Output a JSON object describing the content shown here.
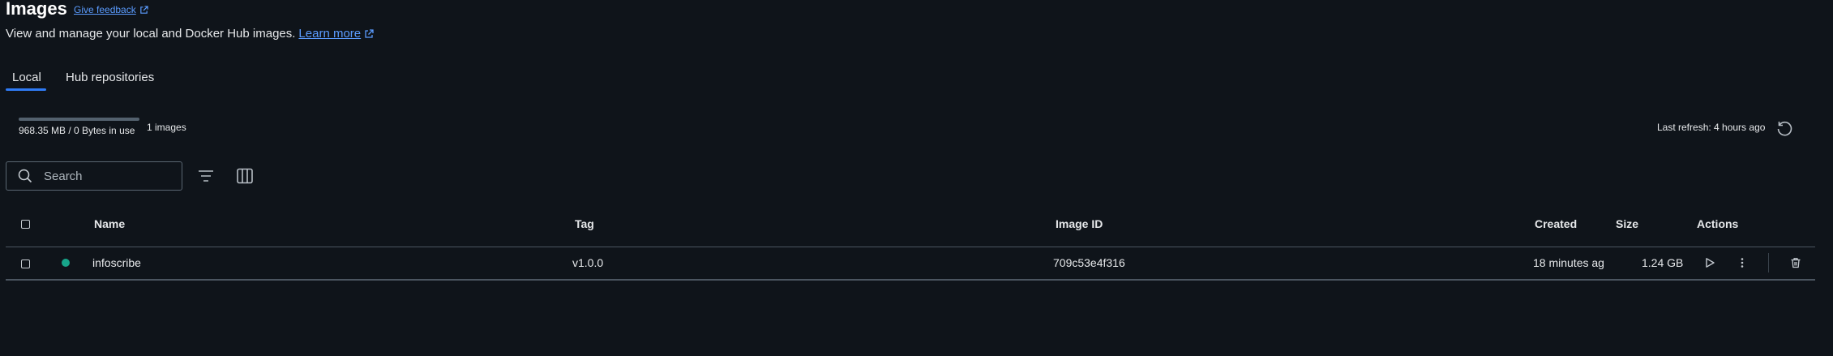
{
  "header": {
    "title": "Images",
    "feedback_label": "Give feedback",
    "subtitle": "View and manage your local and Docker Hub images.",
    "learn_more_label": "Learn more"
  },
  "tabs": [
    {
      "label": "Local",
      "active": true
    },
    {
      "label": "Hub repositories",
      "active": false
    }
  ],
  "usage": {
    "text": "968.35 MB / 0 Bytes in use",
    "count_label": "1 images",
    "last_refresh": "Last refresh: 4 hours ago"
  },
  "search": {
    "placeholder": "Search"
  },
  "table": {
    "columns": [
      "Name",
      "Tag",
      "Image ID",
      "Created",
      "Size",
      "Actions"
    ],
    "rows": [
      {
        "name": "infoscribe",
        "tag": "v1.0.0",
        "image_id": "709c53e4f316",
        "created": "18 minutes ag",
        "size": "1.24 GB",
        "status": "in-use"
      }
    ]
  },
  "icons": {
    "feedback": "external-link-icon",
    "learn_more": "external-link-icon",
    "refresh": "refresh-icon",
    "search": "search-icon",
    "filter": "filter-icon",
    "columns": "columns-icon",
    "run": "play-icon",
    "more": "more-vertical-icon",
    "delete": "trash-icon"
  },
  "colors": {
    "background": "#0f141a",
    "accent": "#2f7bf5",
    "link": "#5b9cff",
    "status_in_use": "#17a58a"
  }
}
